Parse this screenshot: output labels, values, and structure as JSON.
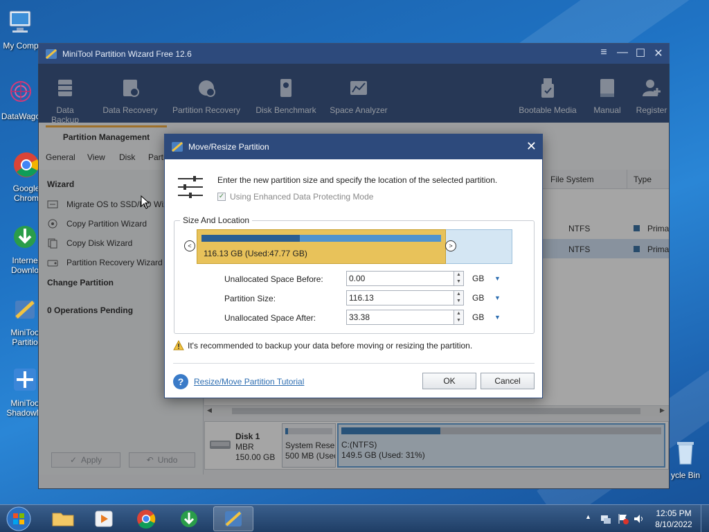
{
  "desktop": {
    "icons": [
      {
        "label": "My Comp"
      },
      {
        "label": "DataWago"
      },
      {
        "label": "Google Chrom"
      },
      {
        "label": "Interne Downlo"
      },
      {
        "label": "MiniToo Partitio"
      },
      {
        "label": "MiniToo ShadowM"
      },
      {
        "label": "ycle Bin"
      }
    ]
  },
  "app": {
    "title": "MiniTool Partition Wizard Free 12.6",
    "toolbar": [
      {
        "label": "Data Backup"
      },
      {
        "label": "Data Recovery"
      },
      {
        "label": "Partition Recovery"
      },
      {
        "label": "Disk Benchmark"
      },
      {
        "label": "Space Analyzer"
      },
      {
        "label": "Bootable Media"
      },
      {
        "label": "Manual"
      },
      {
        "label": "Register"
      }
    ],
    "tab": "Partition Management",
    "menu": [
      "General",
      "View",
      "Disk",
      "Partit"
    ],
    "sidebar": {
      "wizard_heading": "Wizard",
      "wizard_items": [
        "Migrate OS to SSD/HD Wiza",
        "Copy Partition Wizard",
        "Copy Disk Wizard",
        "Partition Recovery Wizard"
      ],
      "change_heading": "Change Partition",
      "pending": "0 Operations Pending",
      "apply": "Apply",
      "undo": "Undo"
    },
    "grid": {
      "columns": [
        "File System",
        "Type"
      ],
      "rows": [
        {
          "fs": "NTFS",
          "type": "Prima"
        },
        {
          "fs": "NTFS",
          "type": "Prima"
        }
      ]
    },
    "diskmap": {
      "disk_name": "Disk 1",
      "disk_type": "MBR",
      "disk_size": "150.00 GB",
      "p1_name": "System Reser",
      "p1_size": "500 MB (Usec",
      "p2_name": "C:(NTFS)",
      "p2_size": "149.5 GB (Used: 31%)",
      "p2_used_fraction": 0.31
    }
  },
  "dialog": {
    "title": "Move/Resize Partition",
    "instruction": "Enter the new partition size and specify the location of the selected partition.",
    "enhanced_mode": "Using Enhanced Data Protecting Mode",
    "group_label": "Size And Location",
    "bar_label": "116.13 GB (Used:47.77 GB)",
    "bar_used_fraction": 0.41,
    "fields": [
      {
        "label": "Unallocated Space Before:",
        "value": "0.00",
        "unit": "GB"
      },
      {
        "label": "Partition Size:",
        "value": "116.13",
        "unit": "GB"
      },
      {
        "label": "Unallocated Space After:",
        "value": "33.38",
        "unit": "GB"
      }
    ],
    "warning": "It's recommended to backup your data before moving or resizing the partition.",
    "tutorial_link": "Resize/Move Partition Tutorial",
    "ok": "OK",
    "cancel": "Cancel"
  },
  "taskbar": {
    "time": "12:05 PM",
    "date": "8/10/2022"
  },
  "colors": {
    "accent": "#2d4a7c",
    "partition_yellow": "#e8c25a",
    "used_blue": "#2e75b6"
  }
}
